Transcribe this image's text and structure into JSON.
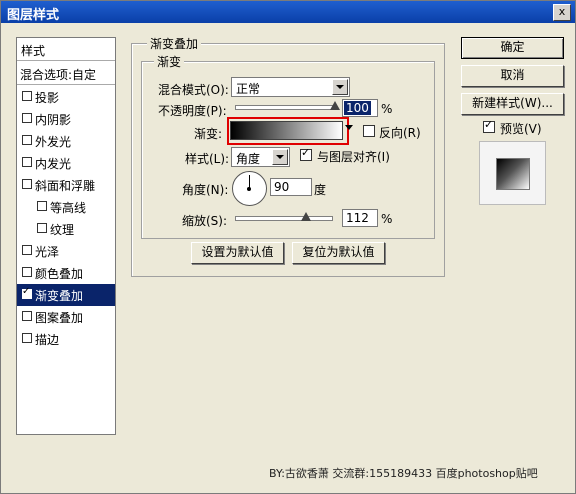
{
  "window": {
    "title": "图层样式",
    "close_glyph": "x"
  },
  "left_list": {
    "header": "样式",
    "blend_options": "混合选项:自定",
    "items": [
      {
        "label": "投影",
        "checked": false
      },
      {
        "label": "内阴影",
        "checked": false
      },
      {
        "label": "外发光",
        "checked": false
      },
      {
        "label": "内发光",
        "checked": false
      },
      {
        "label": "斜面和浮雕",
        "checked": false
      },
      {
        "label": "等高线",
        "checked": false
      },
      {
        "label": "纹理",
        "checked": false
      },
      {
        "label": "光泽",
        "checked": false
      },
      {
        "label": "颜色叠加",
        "checked": false
      },
      {
        "label": "渐变叠加",
        "checked": true,
        "selected": true
      },
      {
        "label": "图案叠加",
        "checked": false
      },
      {
        "label": "描边",
        "checked": false
      }
    ]
  },
  "panel": {
    "outer_title": "渐变叠加",
    "inner_title": "渐变",
    "blend_mode_label": "混合模式(O):",
    "blend_mode_value": "正常",
    "opacity_label": "不透明度(P):",
    "opacity_value": "100",
    "opacity_unit": "%",
    "opacity_fraction": 1.0,
    "gradient_label": "渐变:",
    "gradient_colors": [
      "#000000",
      "#ffffff"
    ],
    "reverse_label": "反向(R)",
    "reverse_checked": false,
    "style_label": "样式(L):",
    "style_value": "角度",
    "align_label": "与图层对齐(I)",
    "align_checked": true,
    "angle_label": "角度(N):",
    "angle_value": "90",
    "angle_unit": "度",
    "scale_label": "缩放(S):",
    "scale_value": "112",
    "scale_unit": "%",
    "scale_fraction": 0.74,
    "set_default_button": "设置为默认值",
    "reset_default_button": "复位为默认值"
  },
  "right_buttons": {
    "ok": "确定",
    "cancel": "取消",
    "new_style": "新建样式(W)...",
    "preview_label": "预览(V)",
    "preview_checked": true
  },
  "footer": "BY:古欲香萧    交流群:155189433    百度photoshop贴吧"
}
